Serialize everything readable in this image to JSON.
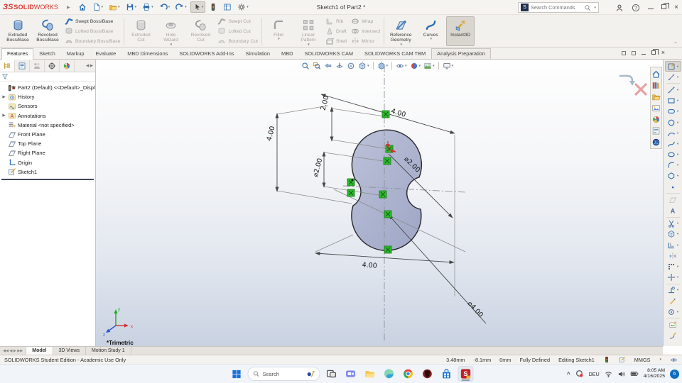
{
  "titlebar": {
    "logo_mark": "ЗS",
    "logo_solid": "SOLID",
    "logo_works": "WORKS",
    "title": "Sketch1 of Part2 *",
    "search_placeholder": "Search Commands",
    "quick_access": [
      {
        "icon": "home"
      },
      {
        "icon": "new-doc",
        "dd": 1
      },
      {
        "icon": "open",
        "dd": 1
      },
      {
        "icon": "save",
        "dd": 1
      },
      {
        "icon": "print",
        "dd": 1
      },
      {
        "icon": "undo",
        "dd": 1
      },
      {
        "icon": "redo",
        "dd": 1
      },
      {
        "icon": "select",
        "pressed": 1,
        "dd": 1
      },
      {
        "icon": "rebuild"
      },
      {
        "icon": "file-properties"
      },
      {
        "icon": "options",
        "dd": 1
      }
    ]
  },
  "ribbon": {
    "groups": [
      {
        "items": [
          {
            "t": "big",
            "label": "Extruded Boss/Base",
            "icon": "extruded-boss",
            "on": 1
          },
          {
            "t": "big",
            "label": "Revolved Boss/Base",
            "icon": "revolved-boss",
            "on": 1
          },
          {
            "t": "stack",
            "buttons": [
              {
                "label": "Swept Boss/Base",
                "icon": "swept-boss",
                "on": 1
              },
              {
                "label": "Lofted Boss/Base",
                "icon": "lofted-boss"
              },
              {
                "label": "Boundary Boss/Base",
                "icon": "boundary-boss"
              }
            ]
          }
        ]
      },
      {
        "items": [
          {
            "t": "big",
            "label": "Extruded Cut",
            "icon": "extruded-cut"
          },
          {
            "t": "big",
            "label": "Hole Wizard",
            "icon": "hole-wizard",
            "dd": 1
          },
          {
            "t": "big",
            "label": "Revolved Cut",
            "icon": "revolved-cut"
          },
          {
            "t": "stack",
            "buttons": [
              {
                "label": "Swept Cut",
                "icon": "swept-cut"
              },
              {
                "label": "Lofted Cut",
                "icon": "lofted-cut"
              },
              {
                "label": "Boundary Cut",
                "icon": "boundary-cut"
              }
            ]
          }
        ]
      },
      {
        "items": [
          {
            "t": "big",
            "label": "Fillet",
            "icon": "fillet",
            "dd": 1
          },
          {
            "t": "big",
            "label": "Linear Pattern",
            "icon": "linear-pattern",
            "dd": 1
          },
          {
            "t": "stack",
            "buttons": [
              {
                "label": "Rib",
                "icon": "rib"
              },
              {
                "label": "Draft",
                "icon": "draft"
              },
              {
                "label": "Shell",
                "icon": "shell"
              }
            ]
          },
          {
            "t": "stack",
            "buttons": [
              {
                "label": "Wrap",
                "icon": "wrap"
              },
              {
                "label": "Intersect",
                "icon": "intersect"
              },
              {
                "label": "Mirror",
                "icon": "mirror"
              }
            ]
          }
        ]
      },
      {
        "items": [
          {
            "t": "big",
            "label": "Reference Geometry",
            "icon": "reference-geometry",
            "on": 1,
            "dd": 1
          },
          {
            "t": "big",
            "label": "Curves",
            "icon": "curves",
            "on": 1,
            "dd": 1
          },
          {
            "t": "big",
            "label": "Instant3D",
            "icon": "instant3d",
            "on": 1,
            "active": 1
          }
        ]
      }
    ]
  },
  "ribbon_tabs": {
    "items": [
      {
        "label": "Features",
        "active": 1
      },
      {
        "label": "Sketch"
      },
      {
        "label": "Markup"
      },
      {
        "label": "Evaluate"
      },
      {
        "label": "MBD Dimensions"
      },
      {
        "label": "SOLIDWORKS Add-Ins"
      },
      {
        "label": "Simulation"
      },
      {
        "label": "MBD"
      },
      {
        "label": "SOLIDWORKS CAM"
      },
      {
        "label": "SOLIDWORKS CAM TBM"
      },
      {
        "label": "Analysis Preparation",
        "boxed": 1
      }
    ]
  },
  "feature_tree": {
    "panel_tabs": [
      "featuremanager",
      "propertymanager",
      "configurationmanager",
      "dimxpertmanager",
      "displaymanager"
    ],
    "items": [
      {
        "icon": "part",
        "label": "Part2 (Default) <<Default>_Displa"
      },
      {
        "icon": "history",
        "label": "History",
        "exp": 1
      },
      {
        "icon": "sensors",
        "label": "Sensors"
      },
      {
        "icon": "annotations",
        "label": "Annotations",
        "exp": 1
      },
      {
        "icon": "material",
        "label": "Material <not specified>"
      },
      {
        "icon": "plane",
        "label": "Front Plane"
      },
      {
        "icon": "plane",
        "label": "Top Plane"
      },
      {
        "icon": "plane",
        "label": "Right Plane"
      },
      {
        "icon": "origin",
        "label": "Origin"
      },
      {
        "icon": "sketch",
        "label": "Sketch1"
      }
    ]
  },
  "headsup": {
    "items": [
      {
        "icon": "zoom-fit"
      },
      {
        "icon": "zoom-area"
      },
      {
        "icon": "previous-view"
      },
      {
        "icon": "section-view"
      },
      {
        "icon": "annotation-views"
      },
      {
        "icon": "view-orientation",
        "dd": 1
      },
      {
        "div": 1
      },
      {
        "icon": "display-style",
        "dd": 1
      },
      {
        "div": 1
      },
      {
        "icon": "hide-show-items",
        "dd": 1
      },
      {
        "icon": "edit-appearance",
        "dd": 1
      },
      {
        "icon": "apply-scene",
        "dd": 1
      },
      {
        "div": 1
      },
      {
        "icon": "view-settings",
        "dd": 1
      }
    ]
  },
  "taskpane": {
    "icons": [
      "resources-home",
      "design-library",
      "file-explorer",
      "view-palette",
      "appearances-scenes",
      "custom-properties",
      "threedexperience"
    ]
  },
  "sketch_toolbar": {
    "items": [
      {
        "icon": "sketch-tool",
        "active": 1,
        "dd": 1
      },
      {
        "icon": "smart-dimension",
        "dd": 1
      },
      {
        "div": 1
      },
      {
        "icon": "line",
        "dd": 1
      },
      {
        "icon": "corner-rectangle",
        "dd": 1
      },
      {
        "icon": "straight-slot",
        "dd": 1
      },
      {
        "icon": "circle",
        "dd": 1
      },
      {
        "icon": "arc",
        "dd": 1
      },
      {
        "icon": "spline",
        "dd": 1
      },
      {
        "icon": "ellipse",
        "dd": 1
      },
      {
        "icon": "sketch-fillet",
        "dd": 1
      },
      {
        "icon": "polygon",
        "dd": 1
      },
      {
        "icon": "point"
      },
      {
        "div": 1
      },
      {
        "icon": "plane",
        "off": 1
      },
      {
        "icon": "text-tool"
      },
      {
        "div": 1
      },
      {
        "icon": "trim-entities",
        "dd": 1
      },
      {
        "icon": "convert-entities",
        "dd": 1
      },
      {
        "icon": "offset-entities",
        "dd": 1
      },
      {
        "icon": "mirror-entities"
      },
      {
        "icon": "linear-sketch-pattern",
        "dd": 1
      },
      {
        "icon": "move-entities",
        "dd": 1
      },
      {
        "div": 1
      },
      {
        "icon": "display-relations",
        "dd": 1
      },
      {
        "icon": "repair-sketch"
      },
      {
        "icon": "quick-snaps",
        "dd": 1
      },
      {
        "div": 1
      },
      {
        "icon": "sketch-picture"
      },
      {
        "icon": "shaded-contours"
      }
    ]
  },
  "sketch": {
    "dims": {
      "d1": "2.00",
      "d2": "4.00",
      "d3": "⌀2.00",
      "d4": "4.00",
      "d5": "⌀2.00",
      "d6": "4.00",
      "d7": "⌀4.00"
    },
    "view_label": "*Trimetric"
  },
  "doc_tabs": {
    "items": [
      {
        "label": "Model",
        "active": 1
      },
      {
        "label": "3D Views"
      },
      {
        "label": "Motion Study 1"
      }
    ]
  },
  "statusbar": {
    "left": "SOLIDWORKS Student Edition - Academic Use Only",
    "x": "3.48mm",
    "y": "-8.1mm",
    "z": "0mm",
    "state": "Fully Defined",
    "mode": "Editing Sketch1",
    "units": "MMGS"
  },
  "taskbar": {
    "search_label": "Search",
    "apps": [
      {
        "icon": "task-view"
      },
      {
        "icon": "chat"
      },
      {
        "icon": "explorer-app"
      },
      {
        "icon": "edge"
      },
      {
        "icon": "chrome"
      },
      {
        "icon": "brave"
      },
      {
        "icon": "store"
      },
      {
        "icon": "solidworks-app",
        "active": 1
      }
    ],
    "tray_lang": "DEU",
    "time": "8:05 AM",
    "date": "4/16/2025",
    "badge": "6"
  }
}
